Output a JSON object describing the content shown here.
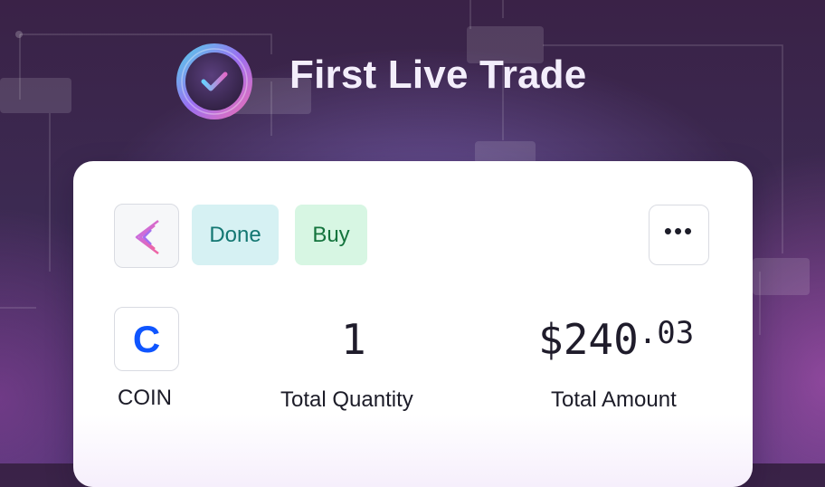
{
  "header": {
    "title": "First Live Trade",
    "logo_icon": "check-circle-icon"
  },
  "card": {
    "app_icon": "broker-chevron-logo-icon",
    "status_badge": "Done",
    "side_badge": "Buy",
    "more_button_icon": "more-horizontal-icon",
    "more_button_glyph": "•••",
    "ticker": {
      "icon": "coinbase-logo-icon",
      "glyph": "C",
      "symbol": "COIN"
    },
    "quantity": {
      "value": "1",
      "label": "Total Quantity"
    },
    "amount": {
      "value_main": "$240",
      "value_cents": ".03",
      "label": "Total Amount"
    }
  },
  "colors": {
    "accent_blue": "#0f55ff",
    "done_bg": "#d6f1f3",
    "done_text": "#137772",
    "buy_bg": "#d7f6e3",
    "buy_text": "#14743d"
  }
}
